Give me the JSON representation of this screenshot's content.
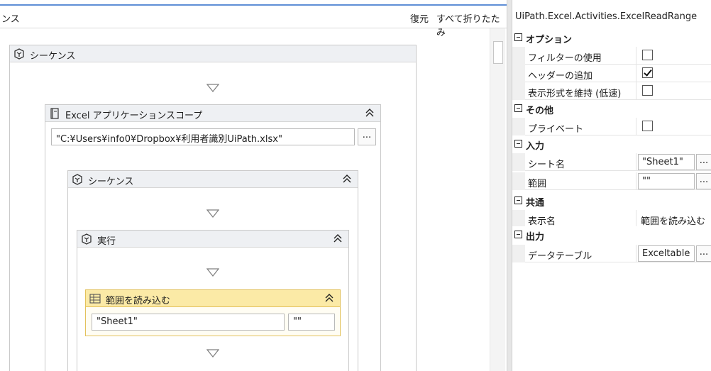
{
  "designer": {
    "title_fragment": "ンス",
    "restore_label": "復元",
    "collapse_all_label": "すべて折りたたみ",
    "sequence_outer": {
      "label": "シーケンス"
    },
    "excel_scope": {
      "label": "Excel アプリケーションスコープ",
      "workbook_path": "\"C:¥Users¥info0¥Dropbox¥利用者識別UiPath.xlsx\"",
      "browse_label": "..."
    },
    "sequence_inner": {
      "label": "シーケンス"
    },
    "execute": {
      "label": "実行"
    },
    "read_range": {
      "label": "範囲を読み込む",
      "sheet_value": "\"Sheet1\"",
      "range_value": "\"\""
    }
  },
  "properties": {
    "title": "UiPath.Excel.Activities.ExcelReadRange",
    "categories": [
      {
        "name": "オプション"
      },
      {
        "name": "その他"
      },
      {
        "name": "入力"
      },
      {
        "name": "共通"
      },
      {
        "name": "出力"
      }
    ],
    "options": {
      "use_filter": {
        "label": "フィルターの使用",
        "checked": false
      },
      "add_headers": {
        "label": "ヘッダーの追加",
        "checked": true
      },
      "preserve_format": {
        "label": "表示形式を維持 (低速)",
        "checked": false
      }
    },
    "misc": {
      "private": {
        "label": "プライベート",
        "checked": false
      }
    },
    "input": {
      "sheet_name": {
        "label": "シート名",
        "value": "\"Sheet1\"",
        "browse": "..."
      },
      "range": {
        "label": "範囲",
        "value": "\"\"",
        "browse": "..."
      }
    },
    "common": {
      "display_name": {
        "label": "表示名",
        "value": "範囲を読み込む"
      }
    },
    "output": {
      "data_table": {
        "label": "データテーブル",
        "value": "Exceltable",
        "browse": "..."
      }
    }
  },
  "colors": {
    "accent_blue": "#5f8fd6",
    "activity_header": "#eef0f3",
    "selected_activity_header": "#fbeaa6",
    "selected_activity_border": "#e3c25c"
  }
}
